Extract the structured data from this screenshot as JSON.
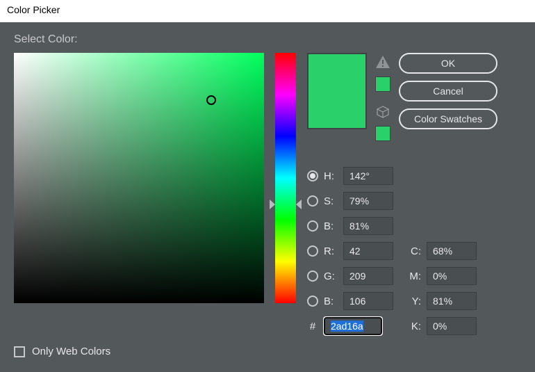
{
  "window": {
    "title": "Color Picker"
  },
  "header": {
    "select_label": "Select Color:"
  },
  "buttons": {
    "ok": "OK",
    "cancel": "Cancel",
    "swatches": "Color Swatches"
  },
  "color": {
    "new_hex": "#2ad16a",
    "prev_hex": "#2ad16a",
    "hue_pct": 60.5,
    "sv_x_pct": 79,
    "sv_y_pct": 19
  },
  "hsb": {
    "h_label": "H:",
    "s_label": "S:",
    "b_label": "B:",
    "h": "142°",
    "s": "79%",
    "b": "81%",
    "selected": "h"
  },
  "rgb": {
    "r_label": "R:",
    "g_label": "G:",
    "b_label": "B:",
    "r": "42",
    "g": "209",
    "b": "106"
  },
  "hex": {
    "value": "2ad16a"
  },
  "cmyk": {
    "c_label": "C:",
    "m_label": "M:",
    "y_label": "Y:",
    "k_label": "K:",
    "c": "68%",
    "m": "0%",
    "y": "81%",
    "k": "0%"
  },
  "webcolors": {
    "label": "Only Web Colors",
    "checked": false
  },
  "icons": {
    "warning": "▲",
    "cube": "⬚"
  }
}
